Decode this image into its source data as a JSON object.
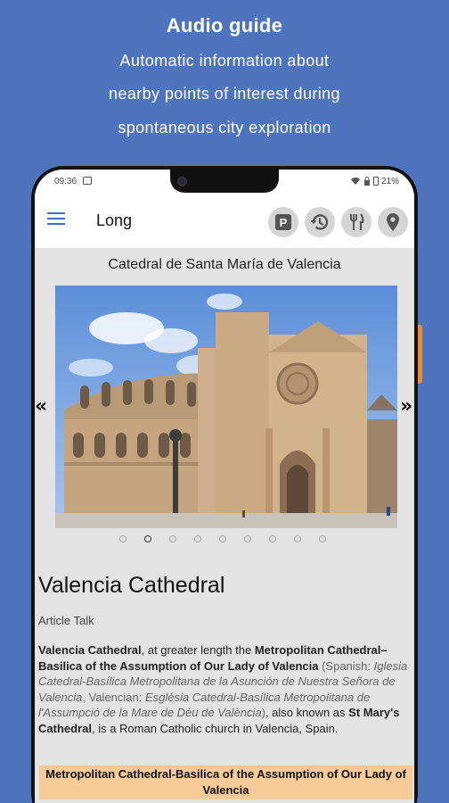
{
  "promo": {
    "title": "Audio guide",
    "line1": "Automatic information about",
    "line2": "nearby points of interest during",
    "line3": "spontaneous city exploration",
    "background_color": "#4f74be"
  },
  "statusbar": {
    "time": "09:36",
    "battery": "21%"
  },
  "appbar": {
    "title": "Long",
    "menu_icon": "hamburger-menu-icon",
    "actions": [
      {
        "name": "parking",
        "icon": "parking-icon",
        "glyph": "P"
      },
      {
        "name": "history",
        "icon": "history-icon"
      },
      {
        "name": "restaurant",
        "icon": "fork-knife-icon"
      },
      {
        "name": "location",
        "icon": "map-pin-icon"
      }
    ],
    "accent_color": "#3a6fd8"
  },
  "gallery": {
    "place_title": "Catedral de Santa María de Valencia",
    "prev_arrow": "«",
    "next_arrow": "»",
    "photo": "valencia-cathedral-photo",
    "dot_count": 9,
    "active_dot": 2
  },
  "article": {
    "heading": "Valencia Cathedral",
    "tab_article": "Article",
    "tab_talk": "Talk",
    "p1_bold": "Valencia Cathedral",
    "p1_text": ", at greater length the ",
    "p1_bold2": "Metropolitan Cathedral–Basilica of the Assumption of Our Lady of Valencia",
    "p1_grey1": " (Spanish: ",
    "p1_italic1": "Iglesia Catedral-Basílica Metropolitana de la Asunción de Nuestra Señora de Valencia",
    "p1_grey2": ", Valencian: ",
    "p1_italic2": "Església Catedral-Basílica Metropolitana de l'Assumpció de la Mare de Déu de València",
    "p1_grey3": ")",
    "p1_text2": ", also known as ",
    "p1_bold3": "St Mary's Cathedral",
    "p1_text3": ", is a Roman Catholic church in Valencia, Spain.",
    "infobox_title": "Metropolitan Cathedral-Basilica of the Assumption of Our Lady of Valencia",
    "infobox_color": "#f6cb96"
  }
}
